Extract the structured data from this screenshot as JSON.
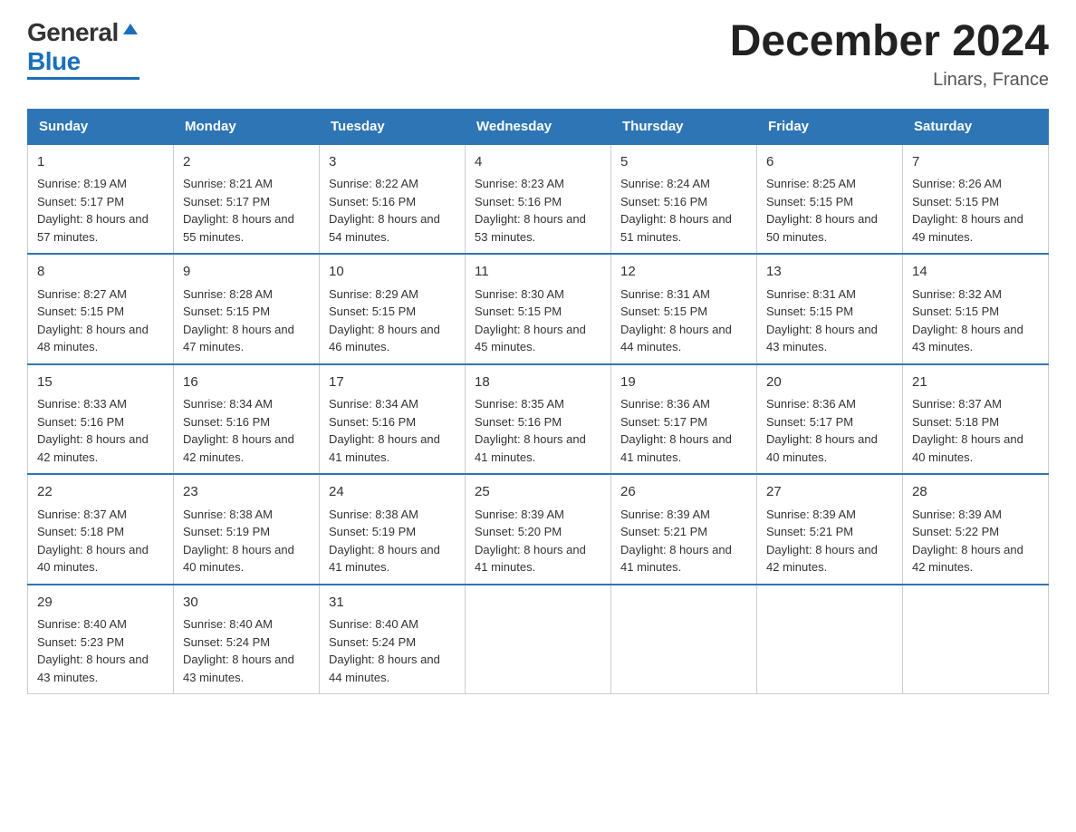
{
  "header": {
    "title": "December 2024",
    "location": "Linars, France",
    "logo_general": "General",
    "logo_blue": "Blue"
  },
  "days_of_week": [
    "Sunday",
    "Monday",
    "Tuesday",
    "Wednesday",
    "Thursday",
    "Friday",
    "Saturday"
  ],
  "weeks": [
    [
      {
        "num": "1",
        "sunrise": "8:19 AM",
        "sunset": "5:17 PM",
        "daylight": "8 hours and 57 minutes."
      },
      {
        "num": "2",
        "sunrise": "8:21 AM",
        "sunset": "5:17 PM",
        "daylight": "8 hours and 55 minutes."
      },
      {
        "num": "3",
        "sunrise": "8:22 AM",
        "sunset": "5:16 PM",
        "daylight": "8 hours and 54 minutes."
      },
      {
        "num": "4",
        "sunrise": "8:23 AM",
        "sunset": "5:16 PM",
        "daylight": "8 hours and 53 minutes."
      },
      {
        "num": "5",
        "sunrise": "8:24 AM",
        "sunset": "5:16 PM",
        "daylight": "8 hours and 51 minutes."
      },
      {
        "num": "6",
        "sunrise": "8:25 AM",
        "sunset": "5:15 PM",
        "daylight": "8 hours and 50 minutes."
      },
      {
        "num": "7",
        "sunrise": "8:26 AM",
        "sunset": "5:15 PM",
        "daylight": "8 hours and 49 minutes."
      }
    ],
    [
      {
        "num": "8",
        "sunrise": "8:27 AM",
        "sunset": "5:15 PM",
        "daylight": "8 hours and 48 minutes."
      },
      {
        "num": "9",
        "sunrise": "8:28 AM",
        "sunset": "5:15 PM",
        "daylight": "8 hours and 47 minutes."
      },
      {
        "num": "10",
        "sunrise": "8:29 AM",
        "sunset": "5:15 PM",
        "daylight": "8 hours and 46 minutes."
      },
      {
        "num": "11",
        "sunrise": "8:30 AM",
        "sunset": "5:15 PM",
        "daylight": "8 hours and 45 minutes."
      },
      {
        "num": "12",
        "sunrise": "8:31 AM",
        "sunset": "5:15 PM",
        "daylight": "8 hours and 44 minutes."
      },
      {
        "num": "13",
        "sunrise": "8:31 AM",
        "sunset": "5:15 PM",
        "daylight": "8 hours and 43 minutes."
      },
      {
        "num": "14",
        "sunrise": "8:32 AM",
        "sunset": "5:15 PM",
        "daylight": "8 hours and 43 minutes."
      }
    ],
    [
      {
        "num": "15",
        "sunrise": "8:33 AM",
        "sunset": "5:16 PM",
        "daylight": "8 hours and 42 minutes."
      },
      {
        "num": "16",
        "sunrise": "8:34 AM",
        "sunset": "5:16 PM",
        "daylight": "8 hours and 42 minutes."
      },
      {
        "num": "17",
        "sunrise": "8:34 AM",
        "sunset": "5:16 PM",
        "daylight": "8 hours and 41 minutes."
      },
      {
        "num": "18",
        "sunrise": "8:35 AM",
        "sunset": "5:16 PM",
        "daylight": "8 hours and 41 minutes."
      },
      {
        "num": "19",
        "sunrise": "8:36 AM",
        "sunset": "5:17 PM",
        "daylight": "8 hours and 41 minutes."
      },
      {
        "num": "20",
        "sunrise": "8:36 AM",
        "sunset": "5:17 PM",
        "daylight": "8 hours and 40 minutes."
      },
      {
        "num": "21",
        "sunrise": "8:37 AM",
        "sunset": "5:18 PM",
        "daylight": "8 hours and 40 minutes."
      }
    ],
    [
      {
        "num": "22",
        "sunrise": "8:37 AM",
        "sunset": "5:18 PM",
        "daylight": "8 hours and 40 minutes."
      },
      {
        "num": "23",
        "sunrise": "8:38 AM",
        "sunset": "5:19 PM",
        "daylight": "8 hours and 40 minutes."
      },
      {
        "num": "24",
        "sunrise": "8:38 AM",
        "sunset": "5:19 PM",
        "daylight": "8 hours and 41 minutes."
      },
      {
        "num": "25",
        "sunrise": "8:39 AM",
        "sunset": "5:20 PM",
        "daylight": "8 hours and 41 minutes."
      },
      {
        "num": "26",
        "sunrise": "8:39 AM",
        "sunset": "5:21 PM",
        "daylight": "8 hours and 41 minutes."
      },
      {
        "num": "27",
        "sunrise": "8:39 AM",
        "sunset": "5:21 PM",
        "daylight": "8 hours and 42 minutes."
      },
      {
        "num": "28",
        "sunrise": "8:39 AM",
        "sunset": "5:22 PM",
        "daylight": "8 hours and 42 minutes."
      }
    ],
    [
      {
        "num": "29",
        "sunrise": "8:40 AM",
        "sunset": "5:23 PM",
        "daylight": "8 hours and 43 minutes."
      },
      {
        "num": "30",
        "sunrise": "8:40 AM",
        "sunset": "5:24 PM",
        "daylight": "8 hours and 43 minutes."
      },
      {
        "num": "31",
        "sunrise": "8:40 AM",
        "sunset": "5:24 PM",
        "daylight": "8 hours and 44 minutes."
      },
      null,
      null,
      null,
      null
    ]
  ],
  "colors": {
    "header_bg": "#2e75b6",
    "header_text": "#ffffff",
    "border": "#cccccc",
    "accent": "#1a6fba"
  }
}
